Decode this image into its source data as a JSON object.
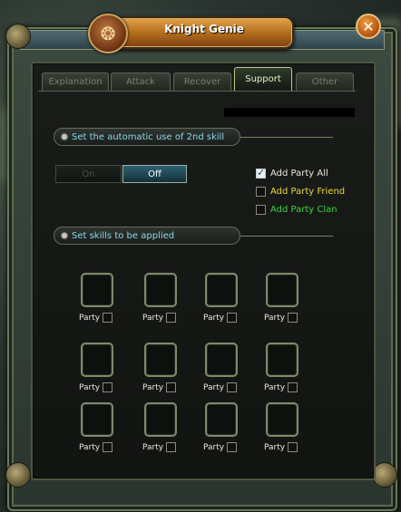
{
  "window": {
    "title": "Knight Genie"
  },
  "tabs": [
    {
      "label": "Explanation",
      "active": false
    },
    {
      "label": "Attack",
      "active": false
    },
    {
      "label": "Recover",
      "active": false
    },
    {
      "label": "Support",
      "active": true
    },
    {
      "label": "Other",
      "active": false
    }
  ],
  "section1": {
    "label": "Set the automatic use of 2nd skill"
  },
  "toggle": {
    "on_label": "On",
    "off_label": "Off",
    "selected": "Off"
  },
  "options": [
    {
      "label": "Add Party All",
      "checked": true,
      "color": "#e8e8e0"
    },
    {
      "label": "Add Party Friend",
      "checked": false,
      "color": "#e8d840"
    },
    {
      "label": "Add Party Clan",
      "checked": false,
      "color": "#40d040"
    }
  ],
  "section2": {
    "label": "Set skills to be applied"
  },
  "slots": {
    "label": "Party",
    "rows": 3,
    "columns": 4
  },
  "colors": {
    "accent_cyan": "#8fd8e8",
    "title_orange": "#b06a1a",
    "frame_green": "#6a7a58"
  }
}
